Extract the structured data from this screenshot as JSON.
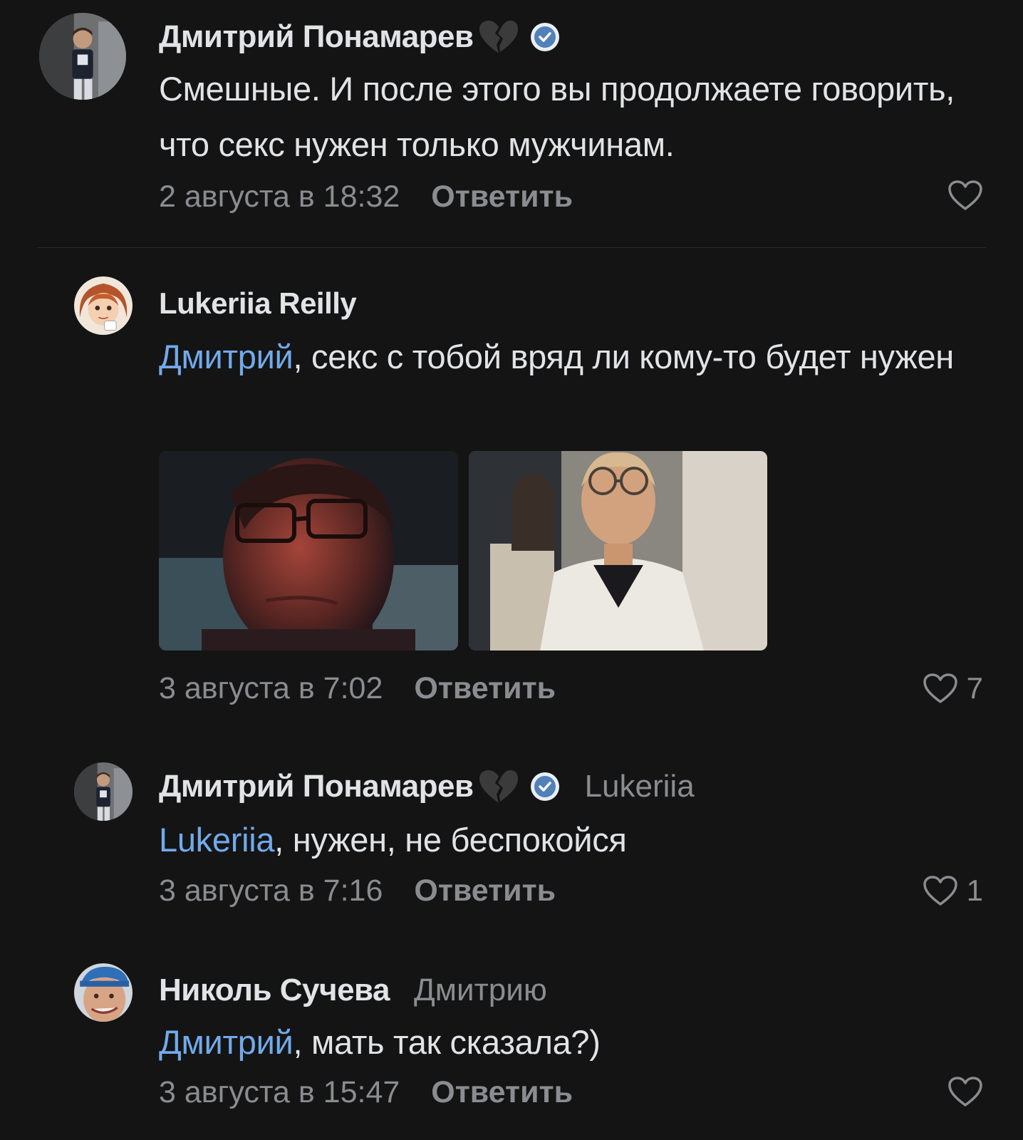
{
  "colors": {
    "background": "#141414",
    "text": "#e1e3e6",
    "secondary": "#8a8c90",
    "link": "#71aaeb",
    "verified": "#5181b8"
  },
  "comments": [
    {
      "author": "Дмитрий Понамарев",
      "emoji": "broken-heart-icon",
      "verified": true,
      "reply_to": "",
      "mention": "",
      "text": "Смешные. И после этого вы продолжаете говорить, что секс нужен только мужчинам.",
      "date": "2 августа в 18:32",
      "reply_label": "Ответить",
      "likes": ""
    },
    {
      "author": "Lukeriia Reilly",
      "emoji": "",
      "verified": false,
      "reply_to": "",
      "mention": "Дмитрий",
      "text": ", секс с тобой вряд ли кому-то будет нужен",
      "date": "3 августа в 7:02",
      "reply_label": "Ответить",
      "likes": "7",
      "attachments": [
        "photo",
        "photo"
      ]
    },
    {
      "author": "Дмитрий Понамарев",
      "emoji": "broken-heart-icon",
      "verified": true,
      "reply_to": "Lukeriia",
      "mention": "Lukeriia",
      "text": ", нужен, не беспокойся",
      "date": "3 августа в 7:16",
      "reply_label": "Ответить",
      "likes": "1"
    },
    {
      "author": "Николь Сучева",
      "emoji": "",
      "verified": false,
      "reply_to": "Дмитрию",
      "mention": "Дмитрий",
      "text": ", мать так сказала?)",
      "date": "3 августа в 15:47",
      "reply_label": "Ответить",
      "likes": ""
    }
  ]
}
